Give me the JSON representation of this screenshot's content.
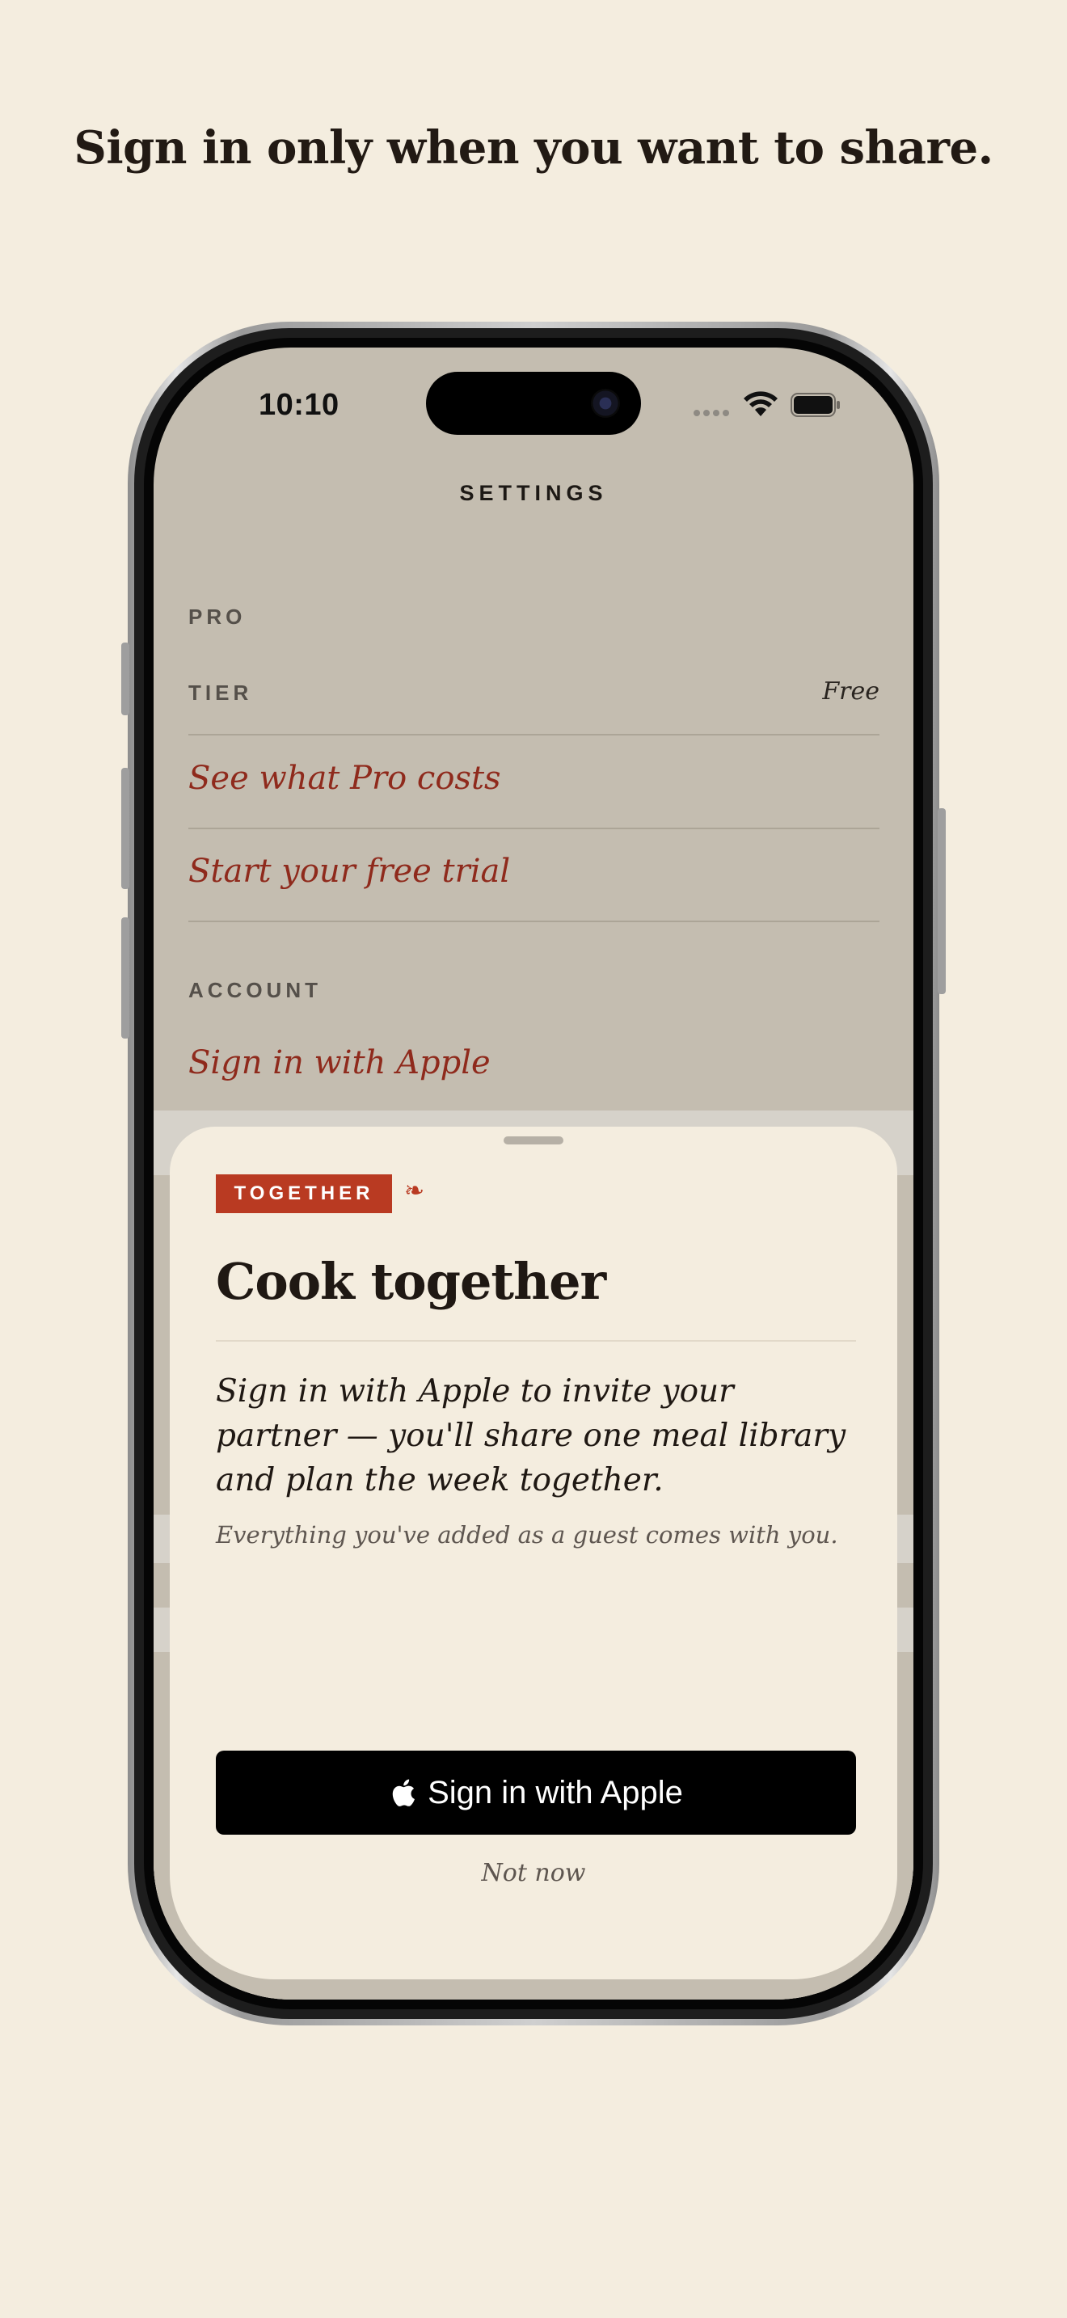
{
  "headline": "Sign in only when you want to share.",
  "status_bar": {
    "time": "10:10",
    "icons": [
      "signal-dots-icon",
      "wifi-icon",
      "battery-icon"
    ]
  },
  "settings": {
    "nav_title": "SETTINGS",
    "sections": {
      "pro": {
        "label": "PRO",
        "tier_label": "TIER",
        "tier_value": "Free",
        "links": [
          "See what Pro costs",
          "Start your free trial"
        ]
      },
      "account": {
        "label": "ACCOUNT",
        "links": [
          "Sign in with Apple"
        ]
      }
    }
  },
  "sheet": {
    "tag": "TOGETHER",
    "fleuron": "❧",
    "title": "Cook together",
    "body": "Sign in with Apple to invite your partner — you'll share one meal library and plan the week together.",
    "note": "Everything you've added as a guest comes with you.",
    "primary_button": "Sign in with Apple",
    "secondary_button": "Not now"
  },
  "colors": {
    "background": "#f4eddf",
    "accent": "#b93a22",
    "link": "#8f2a1c",
    "screen_dim": "#c4bdb0"
  }
}
